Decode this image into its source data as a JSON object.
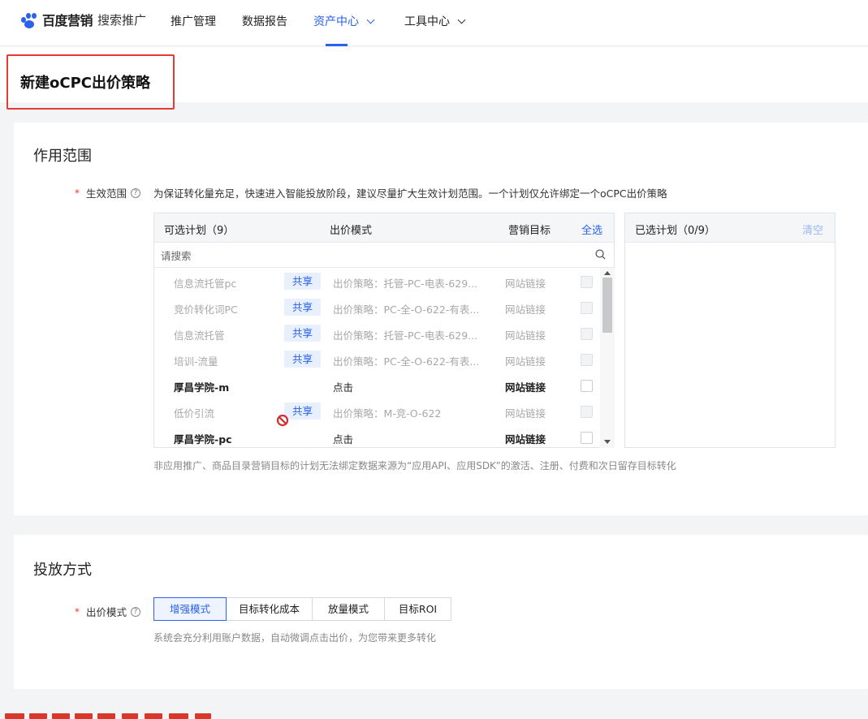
{
  "nav": {
    "brand": "百度营销",
    "product": "搜索推广",
    "items": [
      {
        "label": "推广管理"
      },
      {
        "label": "数据报告"
      },
      {
        "label": "资产中心"
      },
      {
        "label": "工具中心"
      }
    ],
    "active_item": "资产中心"
  },
  "page": {
    "title": "新建oCPC出价策略"
  },
  "scope_section": {
    "title": "作用范围",
    "field_label": "生效范围",
    "hint": "为保证转化量充足，快速进入智能投放阶段，建议尽量扩大生效计划范围。一个计划仅允许绑定一个oCPC出价策略",
    "note": "非应用推广、商品目录营销目标的计划无法绑定数据来源为“应用API、应用SDK”的激活、注册、付费和次日留存目标转化",
    "available": {
      "header_plans": "可选计划（9）",
      "header_bid_mode": "出价模式",
      "header_target": "营销目标",
      "select_all": "全选",
      "search_placeholder": "请搜索",
      "rows": [
        {
          "name": "信息流托管pc",
          "tag": "共享",
          "bid": "出价策略：托管-PC-电表-629...",
          "target": "网站链接",
          "disabled": true
        },
        {
          "name": "竞价转化词PC",
          "tag": "共享",
          "bid": "出价策略：PC-全-O-622-有表...",
          "target": "网站链接",
          "disabled": true
        },
        {
          "name": "信息流托管",
          "tag": "共享",
          "bid": "出价策略：托管-PC-电表-629...",
          "target": "网站链接",
          "disabled": true
        },
        {
          "name": "培训-流量",
          "tag": "共享",
          "bid": "出价策略：PC-全-O-622-有表...",
          "target": "网站链接",
          "disabled": true
        },
        {
          "name": "厚昌学院-m",
          "tag": "",
          "bid": "点击",
          "target": "网站链接",
          "disabled": false
        },
        {
          "name": "低价引流",
          "tag": "共享",
          "bid": "出价策略：M-竞-O-622",
          "target": "网站链接",
          "disabled": true
        },
        {
          "name": "厚昌学院-pc",
          "tag": "",
          "bid": "点击",
          "target": "网站链接",
          "disabled": false
        }
      ]
    },
    "selected": {
      "header": "已选计划（0/9）",
      "clear": "清空"
    }
  },
  "delivery_section": {
    "title": "投放方式",
    "field_label": "出价模式",
    "modes": [
      "增强模式",
      "目标转化成本",
      "放量模式",
      "目标ROI"
    ],
    "active_mode": "增强模式",
    "hint": "系统会充分利用账户数据，自动微调点击出价，为您带来更多转化"
  },
  "colors": {
    "accent": "#2a62e8",
    "highlight_border": "#e53935",
    "tag_bg": "#e8effd"
  }
}
